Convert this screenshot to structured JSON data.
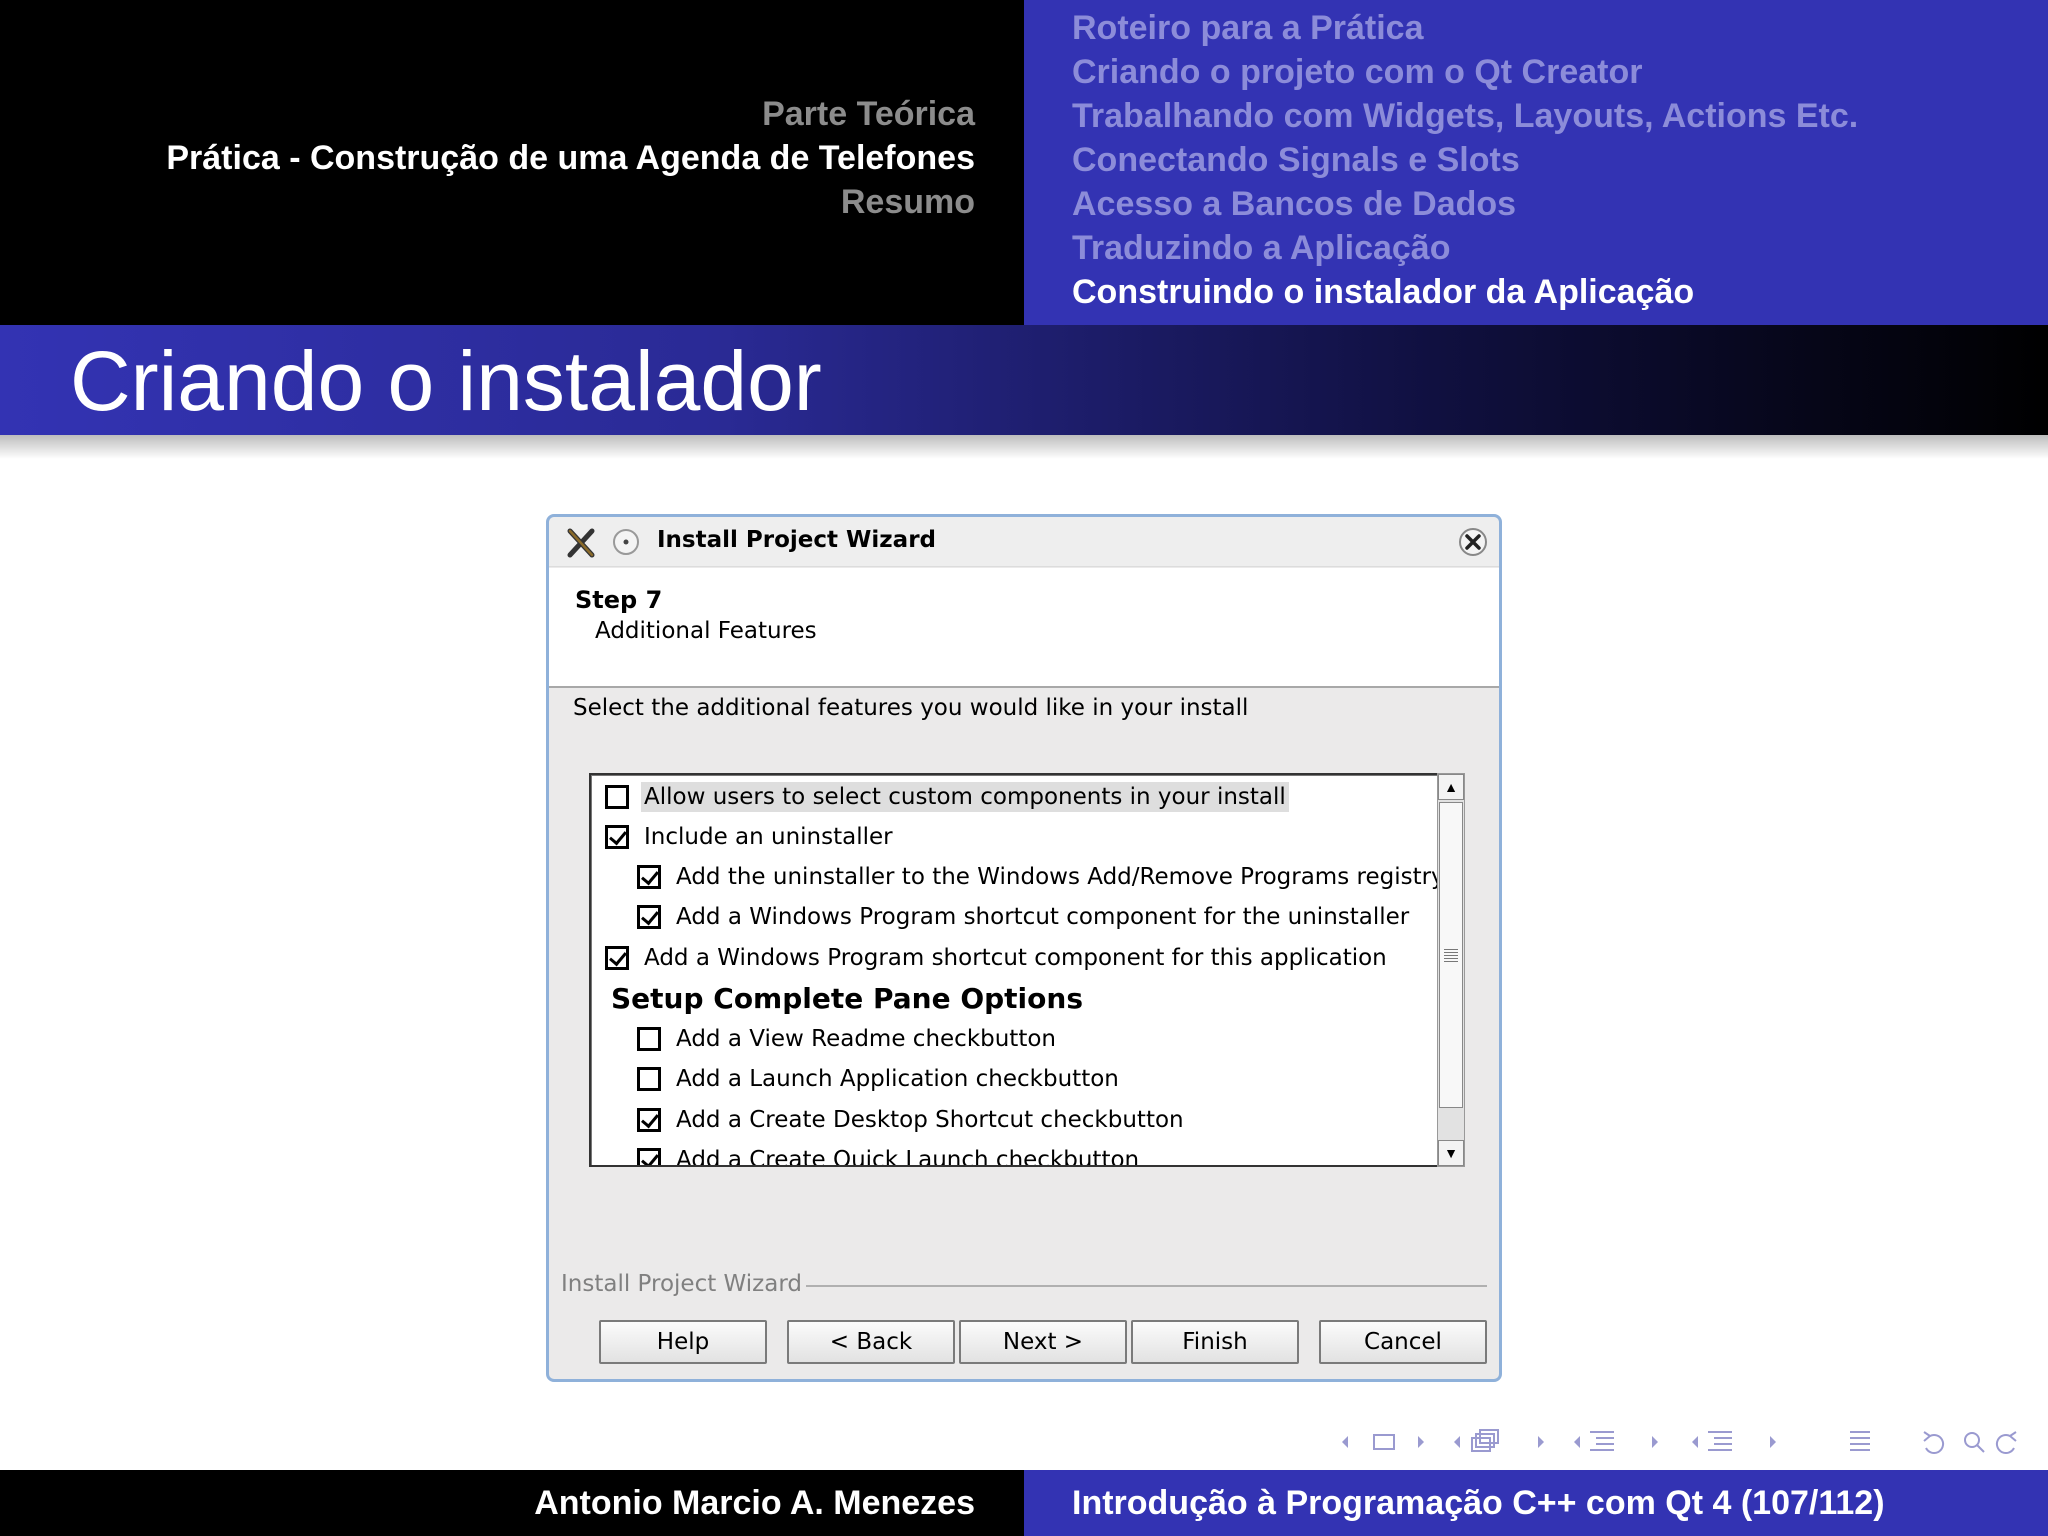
{
  "header": {
    "sections": [
      {
        "label": "Parte Teórica",
        "active": false
      },
      {
        "label": "Prática - Construção de uma Agenda de Telefones",
        "active": true
      },
      {
        "label": "Resumo",
        "active": false
      }
    ],
    "subsections": [
      {
        "label": "Roteiro para a Prática",
        "active": false
      },
      {
        "label": "Criando o projeto com o Qt Creator",
        "active": false
      },
      {
        "label": "Trabalhando com Widgets, Layouts, Actions Etc.",
        "active": false
      },
      {
        "label": "Conectando Signals e Slots",
        "active": false
      },
      {
        "label": "Acesso a Bancos de Dados",
        "active": false
      },
      {
        "label": "Traduzindo a Aplicação",
        "active": false
      },
      {
        "label": "Construindo o instalador da Aplicação",
        "active": true
      }
    ]
  },
  "slide": {
    "title": "Criando o instalador"
  },
  "dialog": {
    "title": "Install Project Wizard",
    "step_title": "Step 7",
    "step_subtitle": "Additional Features",
    "instruction": "Select the additional features you would like in your install",
    "options": [
      {
        "label": "Allow users to select custom components in your install",
        "checked": false,
        "indent": 0,
        "highlighted": true
      },
      {
        "label": "Include an uninstaller",
        "checked": true,
        "indent": 0
      },
      {
        "label": "Add the uninstaller to the Windows Add/Remove Programs registry",
        "checked": true,
        "indent": 1
      },
      {
        "label": "Add a Windows Program shortcut component for the uninstaller",
        "checked": true,
        "indent": 1
      },
      {
        "label": "Add a Windows Program shortcut component for this application",
        "checked": true,
        "indent": 0
      }
    ],
    "section_heading": "Setup Complete Pane Options",
    "pane_options": [
      {
        "label": "Add a View Readme checkbutton",
        "checked": false,
        "indent": 1
      },
      {
        "label": "Add a Launch Application checkbutton",
        "checked": false,
        "indent": 1
      },
      {
        "label": "Add a Create Desktop Shortcut checkbutton",
        "checked": true,
        "indent": 1
      },
      {
        "label": "Add a Create Quick Launch checkbutton",
        "checked": true,
        "indent": 1
      }
    ],
    "frame_label": "Install Project Wizard",
    "buttons": {
      "help": "Help",
      "back": "< Back",
      "next": "Next >",
      "finish": "Finish",
      "cancel": "Cancel"
    }
  },
  "footer": {
    "author": "Antonio Marcio A. Menezes",
    "title": "Introdução à Programação C++ com Qt 4 (107/112)"
  },
  "colors": {
    "header_blue": "#3333b3",
    "inactive_section": "#8c8c8c",
    "inactive_subsection": "#8c8cd9",
    "dialog_border": "#8fb1da"
  },
  "nav_icons": [
    "frame-left-icon",
    "frame-icon",
    "frame-right-icon",
    "subsection-left-icon",
    "subsection-icon",
    "subsection-right-icon",
    "section-left-icon",
    "section-icon",
    "section-right-icon",
    "appendix-left-icon",
    "appendix-icon",
    "appendix-right-icon",
    "list-icon",
    "undo-icon",
    "search-icon",
    "redo-icon"
  ]
}
